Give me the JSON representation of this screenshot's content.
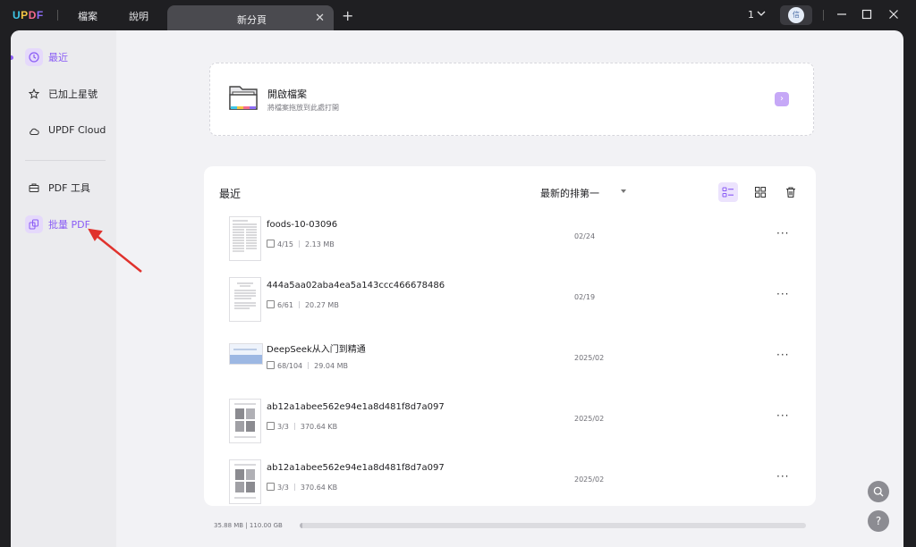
{
  "app": {
    "logo": "UPDF",
    "menu": [
      "檔案",
      "說明"
    ],
    "tab_title": "新分頁",
    "window_count": "1",
    "avatar_initial": "信"
  },
  "sidebar": {
    "items": [
      {
        "label": "最近",
        "icon": "clock-icon"
      },
      {
        "label": "已加上星號",
        "icon": "star-icon"
      },
      {
        "label": "UPDF Cloud",
        "icon": "cloud-icon"
      },
      {
        "label": "PDF 工具",
        "icon": "toolbox-icon"
      },
      {
        "label": "批量 PDF",
        "icon": "batch-icon"
      }
    ]
  },
  "open_file": {
    "title": "開啟檔案",
    "subtitle": "將檔案拖放到此處打開"
  },
  "recent": {
    "title": "最近",
    "sort_label": "最新的排第一",
    "files": [
      {
        "name": "foods-10-03096",
        "pages": "4/15",
        "size": "2.13 MB",
        "date": "02/24"
      },
      {
        "name": "444a5aa02aba4ea5a143ccc466678486",
        "pages": "6/61",
        "size": "20.27 MB",
        "date": "02/19"
      },
      {
        "name": "DeepSeek从入门到精通",
        "pages": "68/104",
        "size": "29.04 MB",
        "date": "2025/02"
      },
      {
        "name": "ab12a1abee562e94e1a8d481f8d7a097",
        "pages": "3/3",
        "size": "370.64 KB",
        "date": "2025/02"
      },
      {
        "name": "ab12a1abee562e94e1a8d481f8d7a097",
        "pages": "3/3",
        "size": "370.64 KB",
        "date": "2025/02"
      }
    ]
  },
  "storage": {
    "text": "35.88 MB | 110.00 GB",
    "used_fraction": 0.0003
  },
  "colors": {
    "accent": "#8a5cf5",
    "annotation_arrow": "#e0322d"
  }
}
